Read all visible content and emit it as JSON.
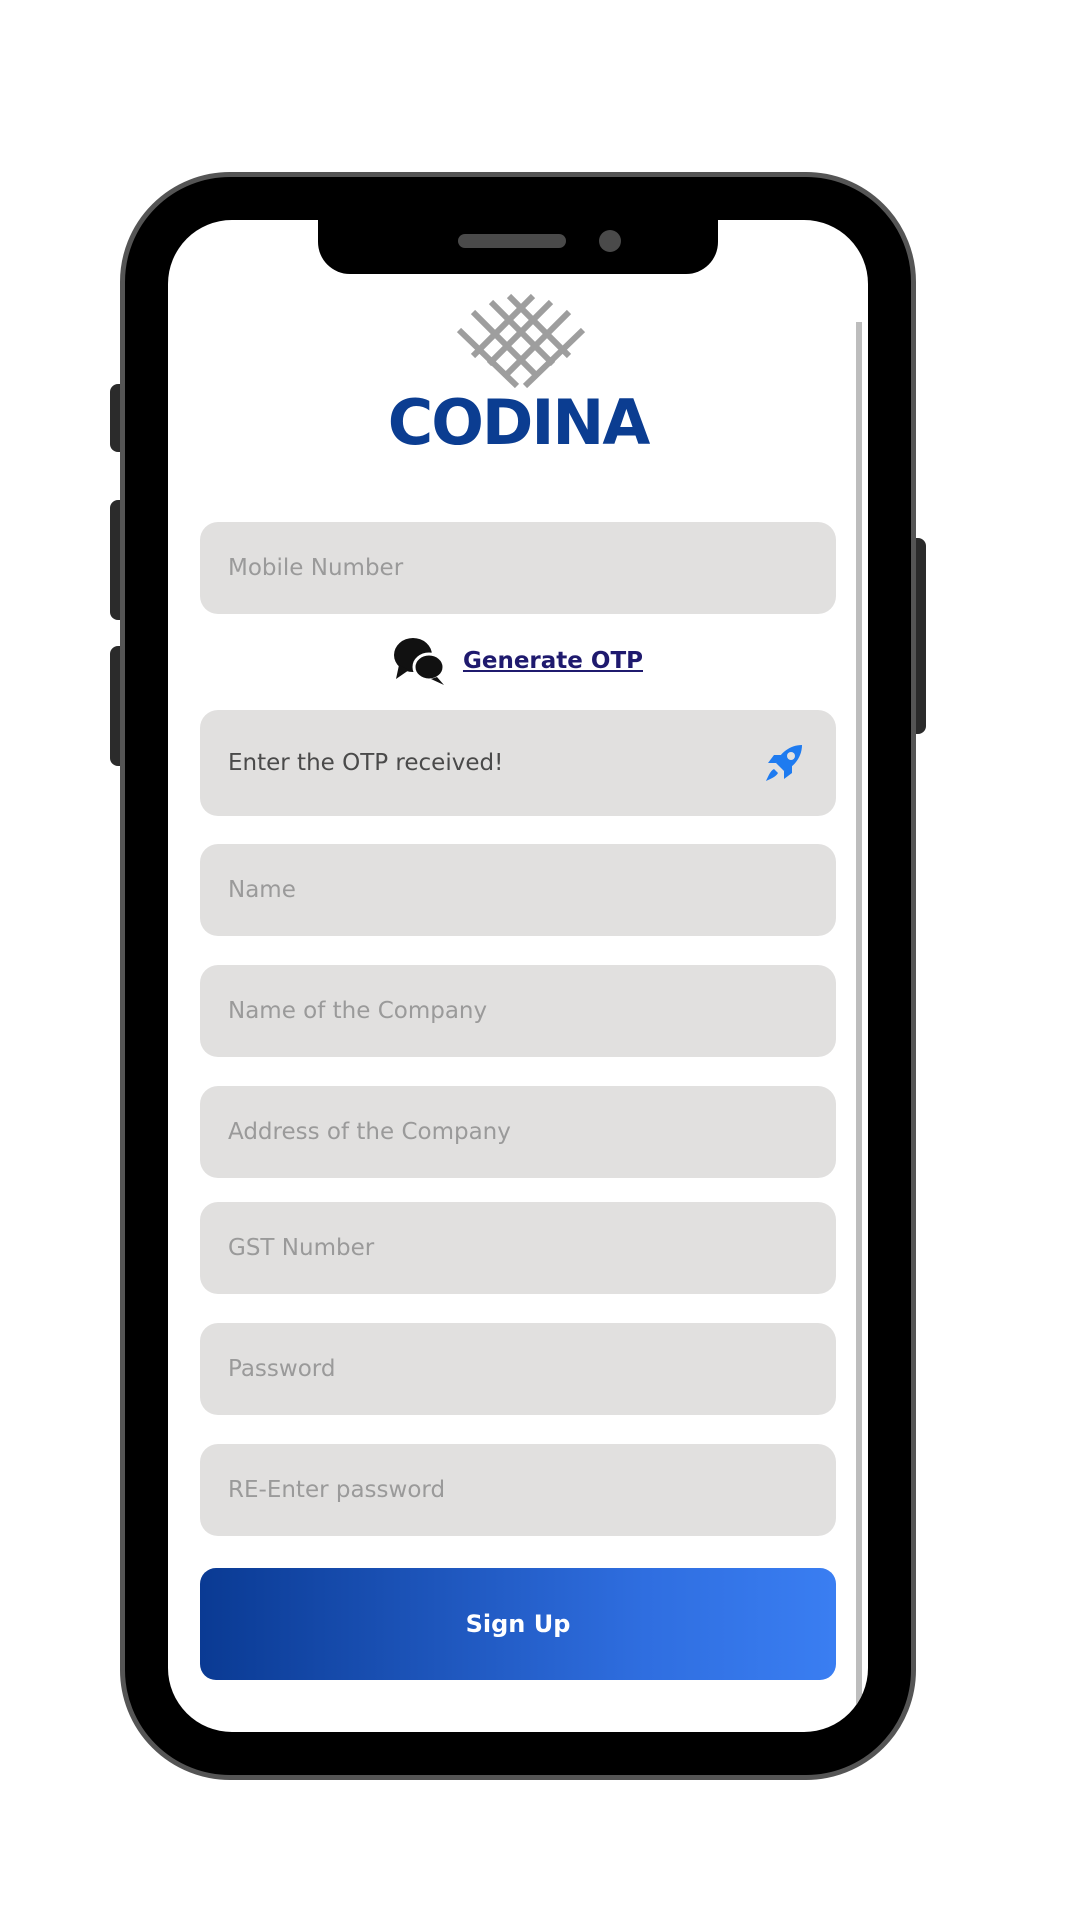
{
  "brand": {
    "name": "CODINA",
    "color": "#0b3d91"
  },
  "form": {
    "mobile_placeholder": "Mobile Number",
    "generate_otp_label": "Generate OTP",
    "otp_text": "Enter the OTP received!",
    "name_placeholder": "Name",
    "company_name_placeholder": "Name of the Company",
    "company_address_placeholder": "Address of the Company",
    "gst_placeholder": "GST Number",
    "password_placeholder": "Password",
    "reenter_password_placeholder": "RE-Enter password",
    "signup_label": "Sign Up"
  },
  "icons": {
    "logo": "woven-mesh-logo",
    "otp": "chat-bubbles-icon",
    "otp_field": "rocket-icon"
  },
  "colors": {
    "field_background": "#e1e0df",
    "placeholder_text": "#9a9a9a",
    "link": "#1f1a6e",
    "button_gradient_start": "#0a3a93",
    "button_gradient_end": "#3a7ef2",
    "rocket": "#1e7bf0"
  }
}
